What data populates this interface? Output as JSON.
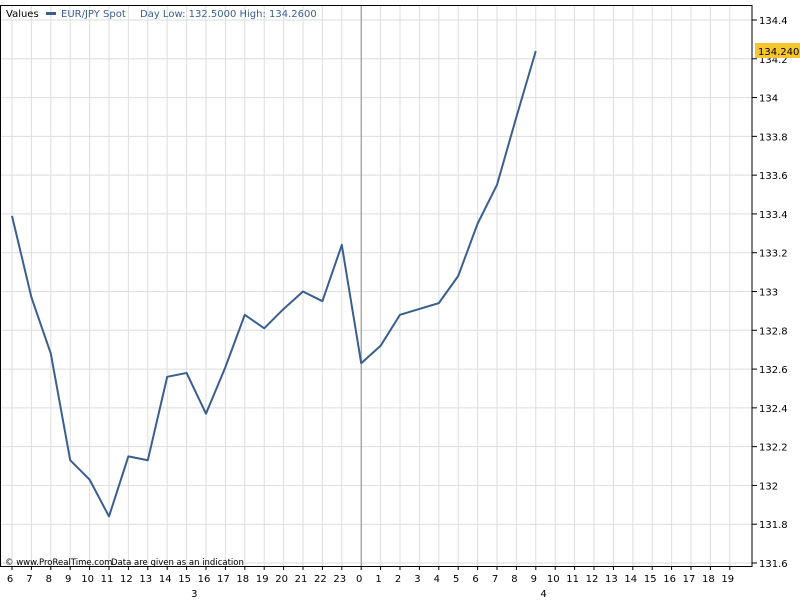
{
  "header": {
    "values_label": "Values",
    "series_label": "EUR/JPY Spot",
    "range_label": "Day Low: 132.5000  High: 134.2600"
  },
  "last_value_label": "134.2400",
  "copyright": "© www.ProRealTime.com",
  "disclaimer": "Data are given as an indication",
  "colors": {
    "line": "#3a5f8f",
    "grid": "#dedede",
    "axis": "#000000",
    "separator": "#8a8a8a",
    "badge": "#f7c62f"
  },
  "chart_data": {
    "type": "line",
    "series": [
      {
        "name": "EUR/JPY Spot",
        "values": [
          133.39,
          132.97,
          132.68,
          132.13,
          132.03,
          131.84,
          132.15,
          132.13,
          132.56,
          132.58,
          132.37,
          132.61,
          132.88,
          132.81,
          132.91,
          133.0,
          132.95,
          133.24,
          132.63,
          132.72,
          132.88,
          132.91,
          132.94,
          133.08,
          133.35,
          133.55,
          133.9,
          134.24
        ]
      }
    ],
    "x_tick_labels": [
      "6",
      "7",
      "8",
      "9",
      "10",
      "11",
      "12",
      "13",
      "14",
      "15",
      "16",
      "17",
      "18",
      "19",
      "20",
      "21",
      "22",
      "23",
      "0",
      "1",
      "2",
      "3",
      "4",
      "5",
      "6",
      "7",
      "8",
      "9",
      "10",
      "11",
      "12",
      "13",
      "14",
      "15",
      "16",
      "17",
      "18",
      "19"
    ],
    "day_labels": [
      {
        "label": "3",
        "tick_index": 9.5
      },
      {
        "label": "4",
        "tick_index": 27.5
      }
    ],
    "separator_tick_index": 18,
    "y_ticks": [
      131.6,
      131.8,
      132,
      132.2,
      132.4,
      132.6,
      132.8,
      133,
      133.2,
      133.4,
      133.6,
      133.8,
      134,
      134.2,
      134.4
    ],
    "y_tick_labels": [
      "131.6",
      "131.8",
      "132",
      "132.2",
      "132.4",
      "132.6",
      "132.8",
      "133",
      "133.2",
      "133.4",
      "133.6",
      "133.8",
      "134",
      "134.2",
      "134.4"
    ],
    "ylim": [
      131.6,
      134.4
    ],
    "grid": true,
    "legend": "top-left"
  }
}
